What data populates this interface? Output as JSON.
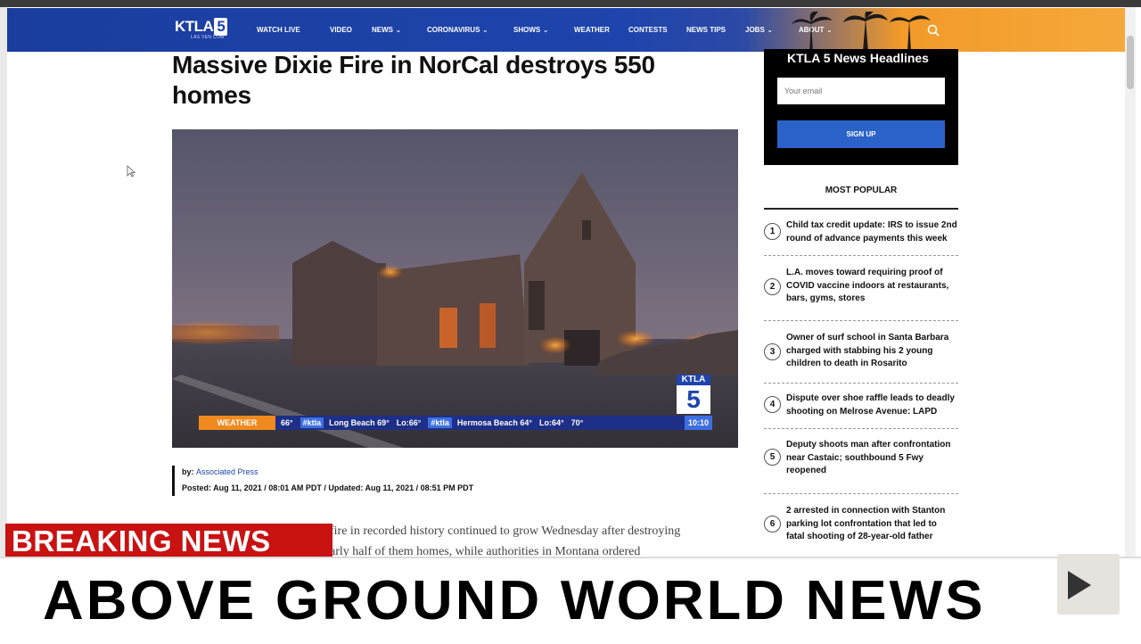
{
  "nav": {
    "logo": "KTLA",
    "logo_num": "5",
    "logo_sub": "LAS VEN COM",
    "items": [
      "WATCH LIVE",
      "VIDEO",
      "NEWS",
      "CORONAVIRUS",
      "SHOWS",
      "WEATHER",
      "CONTESTS",
      "NEWS TIPS",
      "JOBS",
      "ABOUT"
    ],
    "accent": "#1e44ad"
  },
  "article": {
    "headline": "Massive Dixie Fire in NorCal destroys 550 homes",
    "byline_prefix": "by:",
    "author": "Associated Press",
    "posted": "Posted: Aug 11, 2021 / 08:01 AM PDT / Updated: Aug 11, 2021 / 08:51 PM PDT",
    "body_line1": "fire in recorded history continued to grow Wednesday after destroying",
    "body_line2": "arly half of them homes, while authorities in Montana ordered"
  },
  "hero": {
    "ticker_label": "WEATHER",
    "ticker_items": [
      "66°",
      "#ktla",
      "Long Beach 69°",
      "Lo:66°",
      "#ktla",
      "Hermosa Beach 64°",
      "Lo:64°"
    ],
    "ticker_temp": "70°",
    "ticker_time": "10:10",
    "bug_top": "KTLA",
    "bug_num": "5"
  },
  "newsletter": {
    "title": "KTLA 5 News Headlines",
    "email_placeholder": "Your email",
    "button": "SIGN UP"
  },
  "most_popular": {
    "title": "MOST POPULAR",
    "items": [
      {
        "num": "1",
        "text": "Child tax credit update: IRS to issue 2nd round of advance payments this week"
      },
      {
        "num": "2",
        "text": "L.A. moves toward requiring proof of COVID vaccine indoors at restaurants, bars, gyms, stores"
      },
      {
        "num": "3",
        "text": "Owner of surf school in Santa Barbara charged with stabbing his 2 young children to death in Rosarito"
      },
      {
        "num": "4",
        "text": "Dispute over shoe raffle leads to deadly shooting on Melrose Avenue: LAPD"
      },
      {
        "num": "5",
        "text": "Deputy shoots man after confrontation near Castaic; southbound 5 Fwy reopened"
      },
      {
        "num": "6",
        "text": "2 arrested in connection with Stanton parking lot confrontation that led to fatal shooting of 28-year-old father"
      }
    ]
  },
  "overlay": {
    "breaking": "BREAKING NEWS",
    "channel": "ABOVE GROUND WORLD NEWS"
  }
}
